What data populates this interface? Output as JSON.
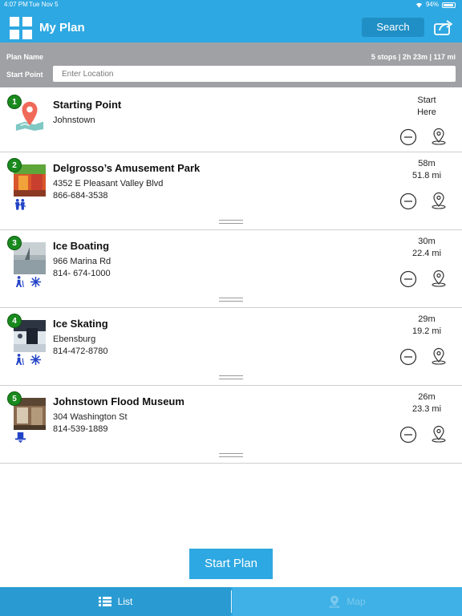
{
  "status_bar": {
    "time": "4:07 PM",
    "date": "Tue Nov 5",
    "battery": "94%"
  },
  "header": {
    "title": "My Plan",
    "search_label": "Search"
  },
  "plan": {
    "name_label": "Plan Name",
    "summary": "5 stops | 2h 23m | 117 mi",
    "start_point_label": "Start Point",
    "location_placeholder": "Enter Location"
  },
  "stops": [
    {
      "number": "1",
      "title": "Starting Point",
      "line1": "Johnstown",
      "line2": "",
      "meta1": "Start",
      "meta2": "Here"
    },
    {
      "number": "2",
      "title": "Delgrosso’s Amusement Park",
      "line1": "4352 E Pleasant Valley Blvd",
      "line2": "866-684-3538",
      "meta1": "58m",
      "meta2": "51.8 mi"
    },
    {
      "number": "3",
      "title": "Ice Boating",
      "line1": "966 Marina Rd",
      "line2": "814- 674-1000",
      "meta1": "30m",
      "meta2": "22.4 mi"
    },
    {
      "number": "4",
      "title": "Ice Skating",
      "line1": "Ebensburg",
      "line2": "814-472-8780",
      "meta1": "29m",
      "meta2": "19.2 mi"
    },
    {
      "number": "5",
      "title": "Johnstown Flood Museum",
      "line1": "304 Washington St",
      "line2": "814-539-1889",
      "meta1": "26m",
      "meta2": "23.3 mi"
    }
  ],
  "actions": {
    "start_plan": "Start Plan"
  },
  "tabs": {
    "list": "List",
    "map": "Map"
  },
  "colors": {
    "brand_blue": "#2ea8e2",
    "badge_green": "#1a8a1e",
    "plan_bar_gray": "#a0a1a4"
  }
}
